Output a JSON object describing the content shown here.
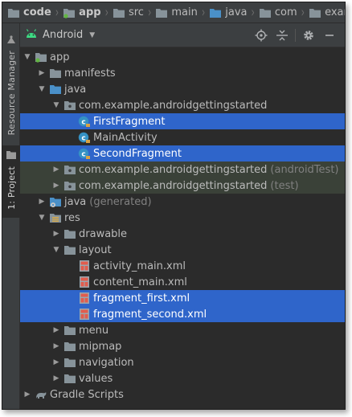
{
  "breadcrumb": [
    {
      "label": "code",
      "icon": "folder-icon",
      "bold": true
    },
    {
      "label": "app",
      "icon": "module-icon",
      "bold": true
    },
    {
      "label": "src",
      "icon": "folder-icon",
      "bold": false
    },
    {
      "label": "main",
      "icon": "folder-icon",
      "bold": false
    },
    {
      "label": "java",
      "icon": "source-folder-icon",
      "bold": false
    },
    {
      "label": "com",
      "icon": "folder-icon",
      "bold": false
    },
    {
      "label": "example",
      "icon": "folder-icon",
      "bold": false
    }
  ],
  "side_tabs": {
    "resource_manager": "Resource Manager",
    "project": "1: Project"
  },
  "toolbar": {
    "view": "Android"
  },
  "tree": [
    {
      "label": "app",
      "depth": 0,
      "arrow": "down",
      "icon": "module-icon"
    },
    {
      "label": "manifests",
      "depth": 1,
      "arrow": "right",
      "icon": "folder-icon"
    },
    {
      "label": "java",
      "depth": 1,
      "arrow": "down",
      "icon": "source-folder-icon"
    },
    {
      "label": "com.example.androidgettingstarted",
      "depth": 2,
      "arrow": "down",
      "icon": "package-icon"
    },
    {
      "label": "FirstFragment",
      "depth": 3,
      "arrow": "none",
      "icon": "class-icon",
      "selected": true
    },
    {
      "label": "MainActivity",
      "depth": 3,
      "arrow": "none",
      "icon": "class-icon"
    },
    {
      "label": "SecondFragment",
      "depth": 3,
      "arrow": "none",
      "icon": "class-icon",
      "selected": true
    },
    {
      "label": "com.example.androidgettingstarted",
      "hint": "(androidTest)",
      "depth": 2,
      "arrow": "right",
      "icon": "package-icon",
      "green": true
    },
    {
      "label": "com.example.androidgettingstarted",
      "hint": "(test)",
      "depth": 2,
      "arrow": "right",
      "icon": "package-icon",
      "green": true
    },
    {
      "label": "java",
      "hint": "(generated)",
      "depth": 1,
      "arrow": "right",
      "icon": "generated-folder-icon"
    },
    {
      "label": "res",
      "depth": 1,
      "arrow": "down",
      "icon": "resource-folder-icon"
    },
    {
      "label": "drawable",
      "depth": 2,
      "arrow": "right",
      "icon": "folder-icon"
    },
    {
      "label": "layout",
      "depth": 2,
      "arrow": "down",
      "icon": "folder-icon"
    },
    {
      "label": "activity_main.xml",
      "depth": 3,
      "arrow": "none",
      "icon": "layout-file-icon"
    },
    {
      "label": "content_main.xml",
      "depth": 3,
      "arrow": "none",
      "icon": "layout-file-icon"
    },
    {
      "label": "fragment_first.xml",
      "depth": 3,
      "arrow": "none",
      "icon": "layout-file-icon",
      "selected": true
    },
    {
      "label": "fragment_second.xml",
      "depth": 3,
      "arrow": "none",
      "icon": "layout-file-icon",
      "selected": true
    },
    {
      "label": "menu",
      "depth": 2,
      "arrow": "right",
      "icon": "folder-icon"
    },
    {
      "label": "mipmap",
      "depth": 2,
      "arrow": "right",
      "icon": "folder-icon"
    },
    {
      "label": "navigation",
      "depth": 2,
      "arrow": "right",
      "icon": "folder-icon"
    },
    {
      "label": "values",
      "depth": 2,
      "arrow": "right",
      "icon": "folder-icon"
    },
    {
      "label": "Gradle Scripts",
      "depth": 0,
      "arrow": "right",
      "icon": "gradle-icon"
    }
  ],
  "colors": {
    "selection": "#2f65ca",
    "test_scope": "#3a4138",
    "background": "#2b2b2b",
    "panel": "#3c3f41"
  }
}
